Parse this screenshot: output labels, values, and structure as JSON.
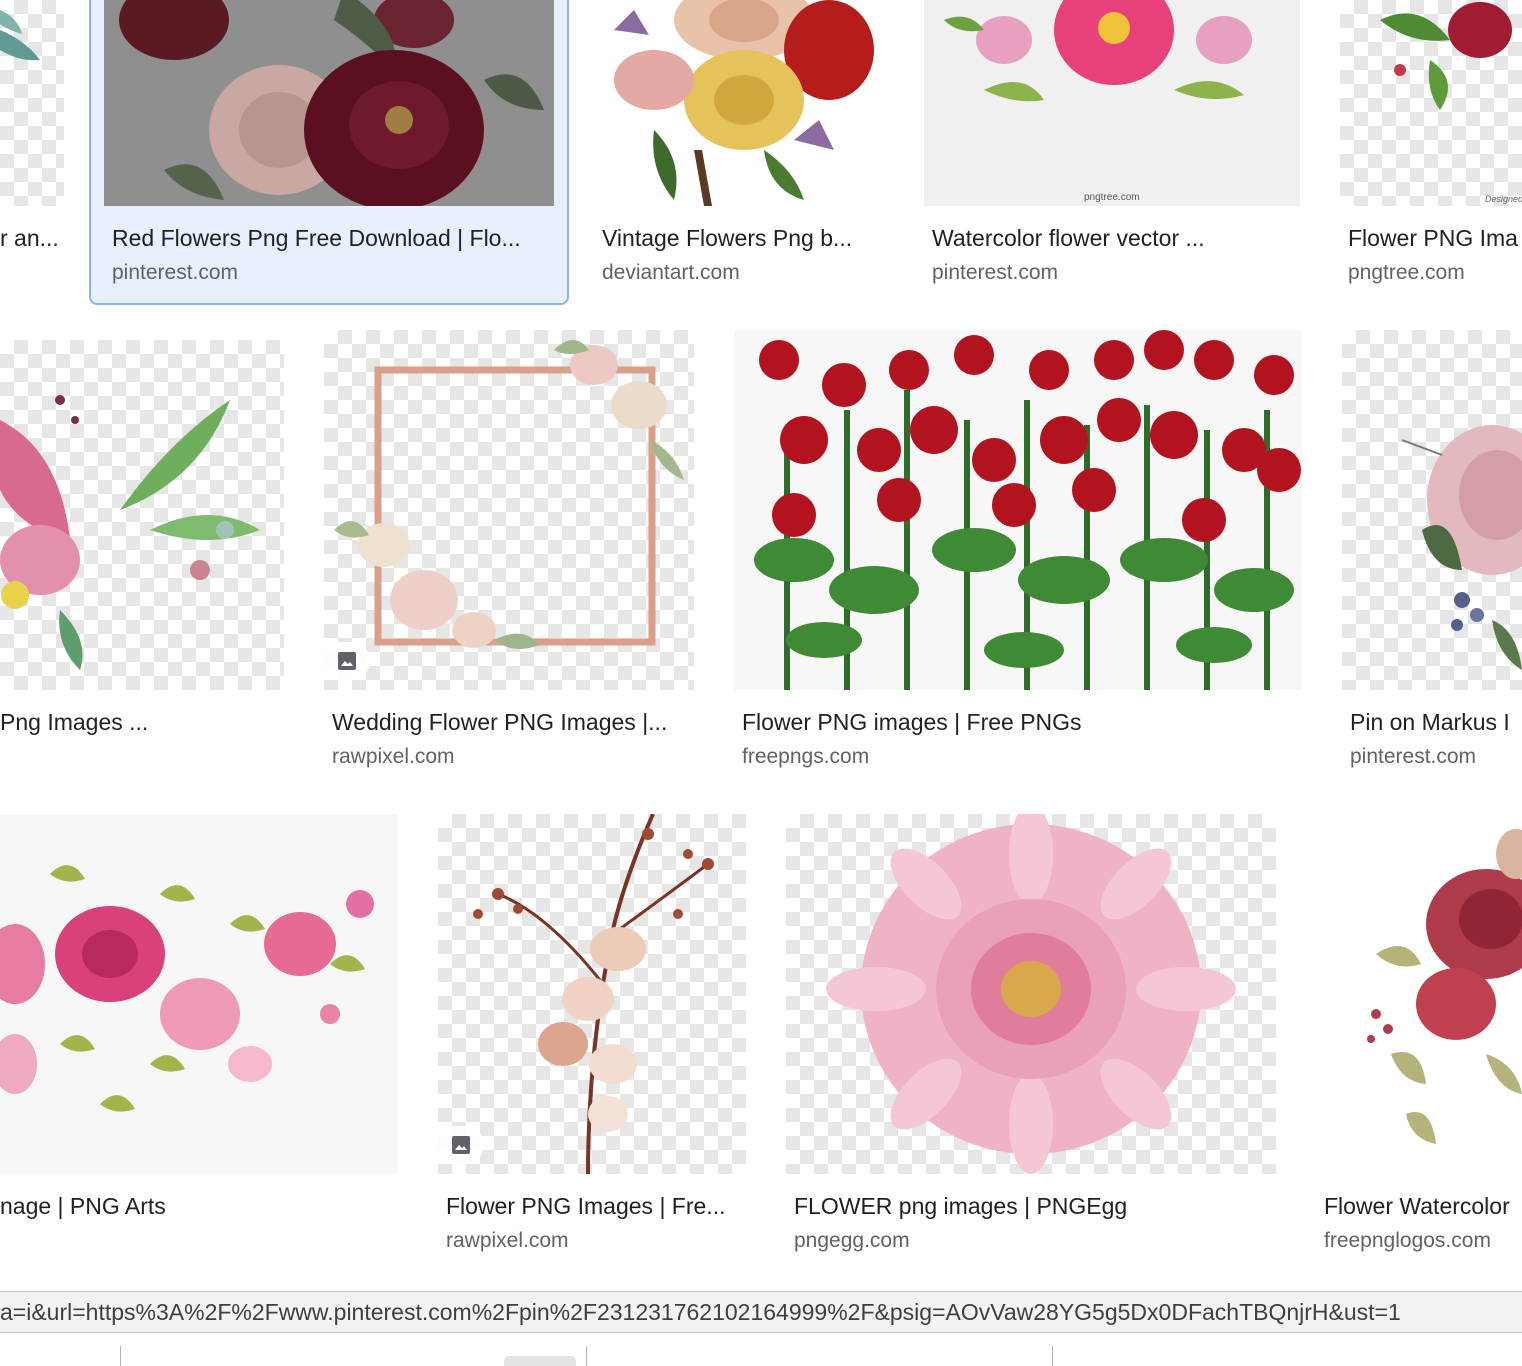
{
  "results": [
    {
      "caption": "r an...",
      "source": ""
    },
    {
      "caption": "Red Flowers Png Free Download | Flo...",
      "source": "pinterest.com",
      "selected": true
    },
    {
      "caption": "Vintage Flowers Png b...",
      "source": "deviantart.com"
    },
    {
      "caption": "Watercolor flower vector ...",
      "source": "pinterest.com",
      "watermark": "pngtree.com"
    },
    {
      "caption": "Flower PNG Ima",
      "source": "pngtree.com",
      "watermark": "Designed"
    },
    {
      "caption": "Png Images ...",
      "source": ""
    },
    {
      "caption": "Wedding Flower PNG Images |...",
      "source": "rawpixel.com"
    },
    {
      "caption": "Flower PNG images | Free PNGs",
      "source": "freepngs.com"
    },
    {
      "caption": "Pin on Markus I",
      "source": "pinterest.com"
    },
    {
      "caption": "nage | PNG Arts",
      "source": ""
    },
    {
      "caption": "Flower PNG Images | Fre...",
      "source": "rawpixel.com"
    },
    {
      "caption": "FLOWER png images | PNGEgg",
      "source": "pngegg.com"
    },
    {
      "caption": "Flower Watercolor",
      "source": "freepnglogos.com"
    }
  ],
  "status_bar": {
    "url": "a=i&url=https%3A%2F%2Fwww.pinterest.com%2Fpin%2F231231762102164999%2F&psig=AOvVaw28YG5g5Dx0DFachTBQnjrH&ust=1"
  },
  "icons": {
    "image_badge": "image-icon"
  },
  "colors": {
    "selected_border": "#8ab4f8",
    "selected_background": "#e8f0fe",
    "caption_text": "#202124",
    "source_text": "#5f6368"
  }
}
